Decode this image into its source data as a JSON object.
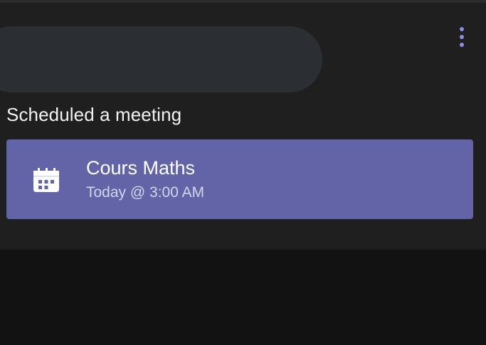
{
  "activity": {
    "text": "Scheduled a meeting"
  },
  "meeting": {
    "title": "Cours Maths",
    "time": "Today @ 3:00 AM",
    "icon": "calendar-icon",
    "color": "#6264a7"
  },
  "menu": {
    "icon": "more-vertical-icon",
    "color": "#8c8ce6"
  }
}
